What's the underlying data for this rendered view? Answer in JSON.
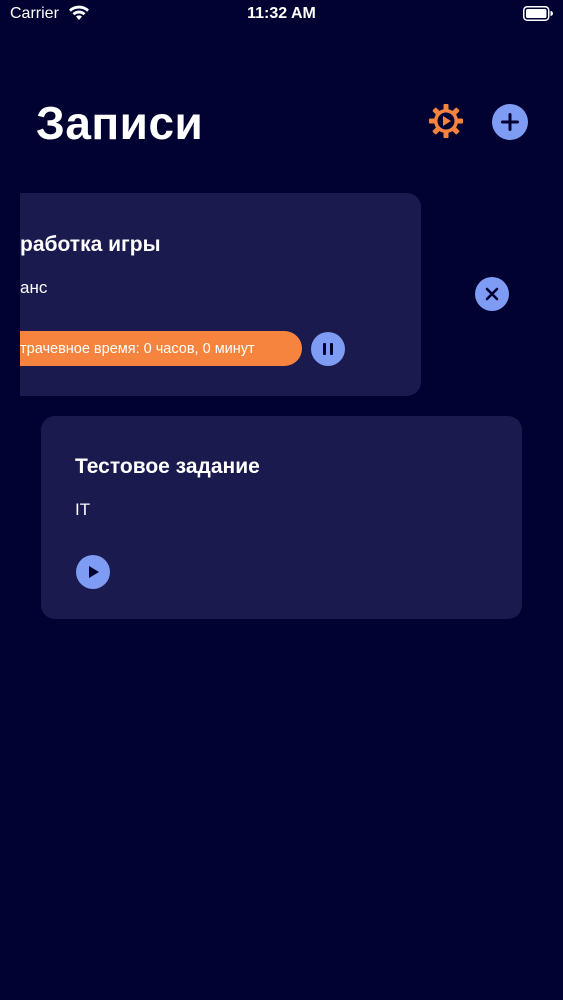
{
  "status_bar": {
    "carrier": "Carrier",
    "time": "11:32 AM"
  },
  "header": {
    "title": "Записи",
    "settings_icon": "gear-icon",
    "add_icon": "plus-icon"
  },
  "records": [
    {
      "title": "работка игры",
      "category": "анс",
      "time_spent": "трачевное время: 0 часов, 0 минут",
      "state": "running",
      "control_icon": "pause-icon"
    },
    {
      "title": "Тестовое задание",
      "category": "IT",
      "state": "stopped",
      "control_icon": "play-icon"
    }
  ],
  "colors": {
    "background": "#020232",
    "card": "#1a1a4e",
    "accent_blue": "#7e9cf3",
    "accent_orange": "#f7843e"
  }
}
